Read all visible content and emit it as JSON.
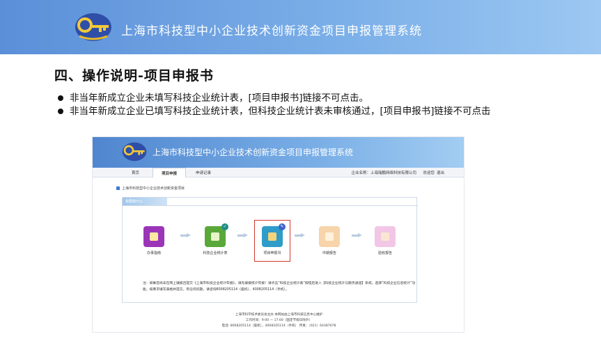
{
  "header": {
    "title": "上海市科技型中小企业技术创新资金项目申报管理系统",
    "logo_icon": "key-logo-icon"
  },
  "section": {
    "heading": "四、操作说明-项目申报书"
  },
  "bullets": [
    "非当年新成立企业未填写科技企业统计表，[项目申报书]链接不可点击。",
    "非当年新成立企业已填写科技企业统计表，但科技企业统计表未审核通过，[项目申报书]链接不可点击"
  ],
  "screenshot": {
    "banner_title": "上海市科技型中小企业技术创新资金项目申报管理系统",
    "nav": {
      "home": "首页",
      "project": "项目申报",
      "records": "申请记录",
      "company": "企业名称：上海瑞鹏网络科技有限公司",
      "welcome": "欢迎您",
      "logout": "退出"
    },
    "breadcrumb": "上海市科技型中小企业技术创新资金项目",
    "panel_tab": "我要做什么",
    "steps": [
      {
        "label": "办事指南",
        "color": "#9b35b8"
      },
      {
        "label": "科技企业统计表",
        "color": "#5aa83a"
      },
      {
        "label": "项目申报书",
        "color": "#2f9cc9"
      },
      {
        "label": "中期报告",
        "color": "#f7d4a9"
      },
      {
        "label": "验收报告",
        "color": "#f2c7e6"
      }
    ],
    "note": "注：如果您尚未在网上填报且提交《上海市科技企业统计年报》，请先填报统计年报！请点击“科技企业统计表”按钮后进入【科技企业统计与服务通道】系统，选择“科技企业信息统计”功能，按要求填写表格并提交。有任何问题，请咨询8008205114（座机）、4008205114（手机）。",
    "footer": [
      "上海市科学技术委员会主办 本网站由上海市科技信息中心维护",
      "工作时间：9:00 — 17:00（国定节假日除外）",
      "电话: 8008205114（座机），4008205114（手机） 传真：（021）64387678"
    ]
  }
}
